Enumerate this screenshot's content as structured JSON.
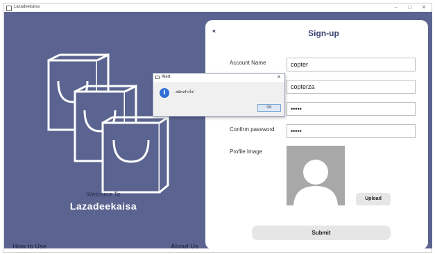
{
  "window": {
    "title": "Lazadeekaisa",
    "controls": {
      "minimize": "–",
      "maximize": "□",
      "close": "✕"
    }
  },
  "left_panel": {
    "welcome_text": "Welcome To",
    "brand_name": "Lazadeekaisa",
    "how_to_use": "How to Use",
    "about_us": "About Us",
    "icon": "shopping-bags-icon"
  },
  "signup": {
    "back_icon": "«",
    "title": "Sign-up",
    "fields": {
      "account_name": {
        "label": "Account Name",
        "value": "copter"
      },
      "username": {
        "value": "copterza"
      },
      "password": {
        "value": "•••••"
      },
      "confirm_password": {
        "label": "Confirm password",
        "value": "•••••"
      }
    },
    "profile_label": "Profile Image",
    "upload_label": "Upload",
    "submit_label": "Submit"
  },
  "alert": {
    "title": "Alert",
    "close": "✕",
    "info_glyph": "i",
    "message": "สมัครสำเร็จ!",
    "ok_label": "OK"
  },
  "colors": {
    "panel_background": "#5b6490",
    "title_text": "#3b4575",
    "info_blue": "#2f6fd6"
  }
}
